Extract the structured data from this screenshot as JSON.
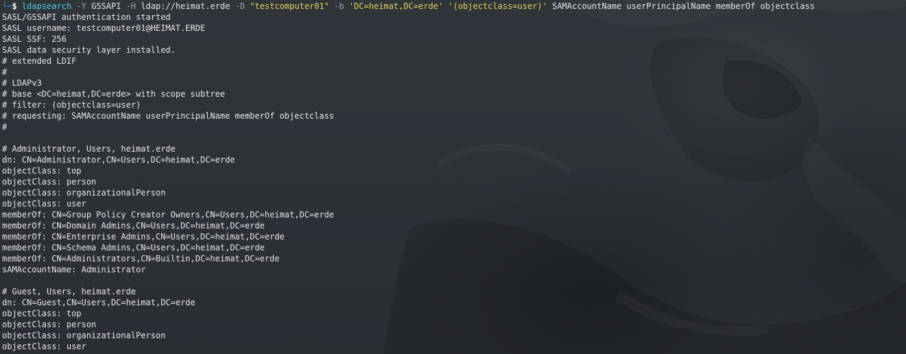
{
  "terminal": {
    "prompt": {
      "corner": "└─",
      "dollar": "$"
    },
    "command": {
      "program": "ldapsearch",
      "opt_y": "-Y",
      "arg_y": "GSSAPI",
      "opt_h": "-H",
      "arg_h": "ldap://heimat.erde",
      "opt_d": "-D",
      "arg_d": "\"testcomputer01\"",
      "opt_b": "-b",
      "arg_b": "'DC=heimat,DC=erde'",
      "filter_open": "'(",
      "filter_body": "objectclass=user",
      "filter_close": ")'",
      "attributes": "SAMAccountName userPrincipalName memberOf objectclass"
    },
    "output_lines": [
      "SASL/GSSAPI authentication started",
      "SASL username: testcomputer01@HEIMAT.ERDE",
      "SASL SSF: 256",
      "SASL data security layer installed.",
      "# extended LDIF",
      "#",
      "# LDAPv3",
      "# base <DC=heimat,DC=erde> with scope subtree",
      "# filter: (objectclass=user)",
      "# requesting: SAMAccountName userPrincipalName memberOf objectclass",
      "#",
      "",
      "# Administrator, Users, heimat.erde",
      "dn: CN=Administrator,CN=Users,DC=heimat,DC=erde",
      "objectClass: top",
      "objectClass: person",
      "objectClass: organizationalPerson",
      "objectClass: user",
      "memberOf: CN=Group Policy Creator Owners,CN=Users,DC=heimat,DC=erde",
      "memberOf: CN=Domain Admins,CN=Users,DC=heimat,DC=erde",
      "memberOf: CN=Enterprise Admins,CN=Users,DC=heimat,DC=erde",
      "memberOf: CN=Schema Admins,CN=Users,DC=heimat,DC=erde",
      "memberOf: CN=Administrators,CN=Builtin,DC=heimat,DC=erde",
      "sAMAccountName: Administrator",
      "",
      "# Guest, Users, heimat.erde",
      "dn: CN=Guest,CN=Users,DC=heimat,DC=erde",
      "objectClass: top",
      "objectClass: person",
      "objectClass: organizationalPerson",
      "objectClass: user"
    ]
  }
}
